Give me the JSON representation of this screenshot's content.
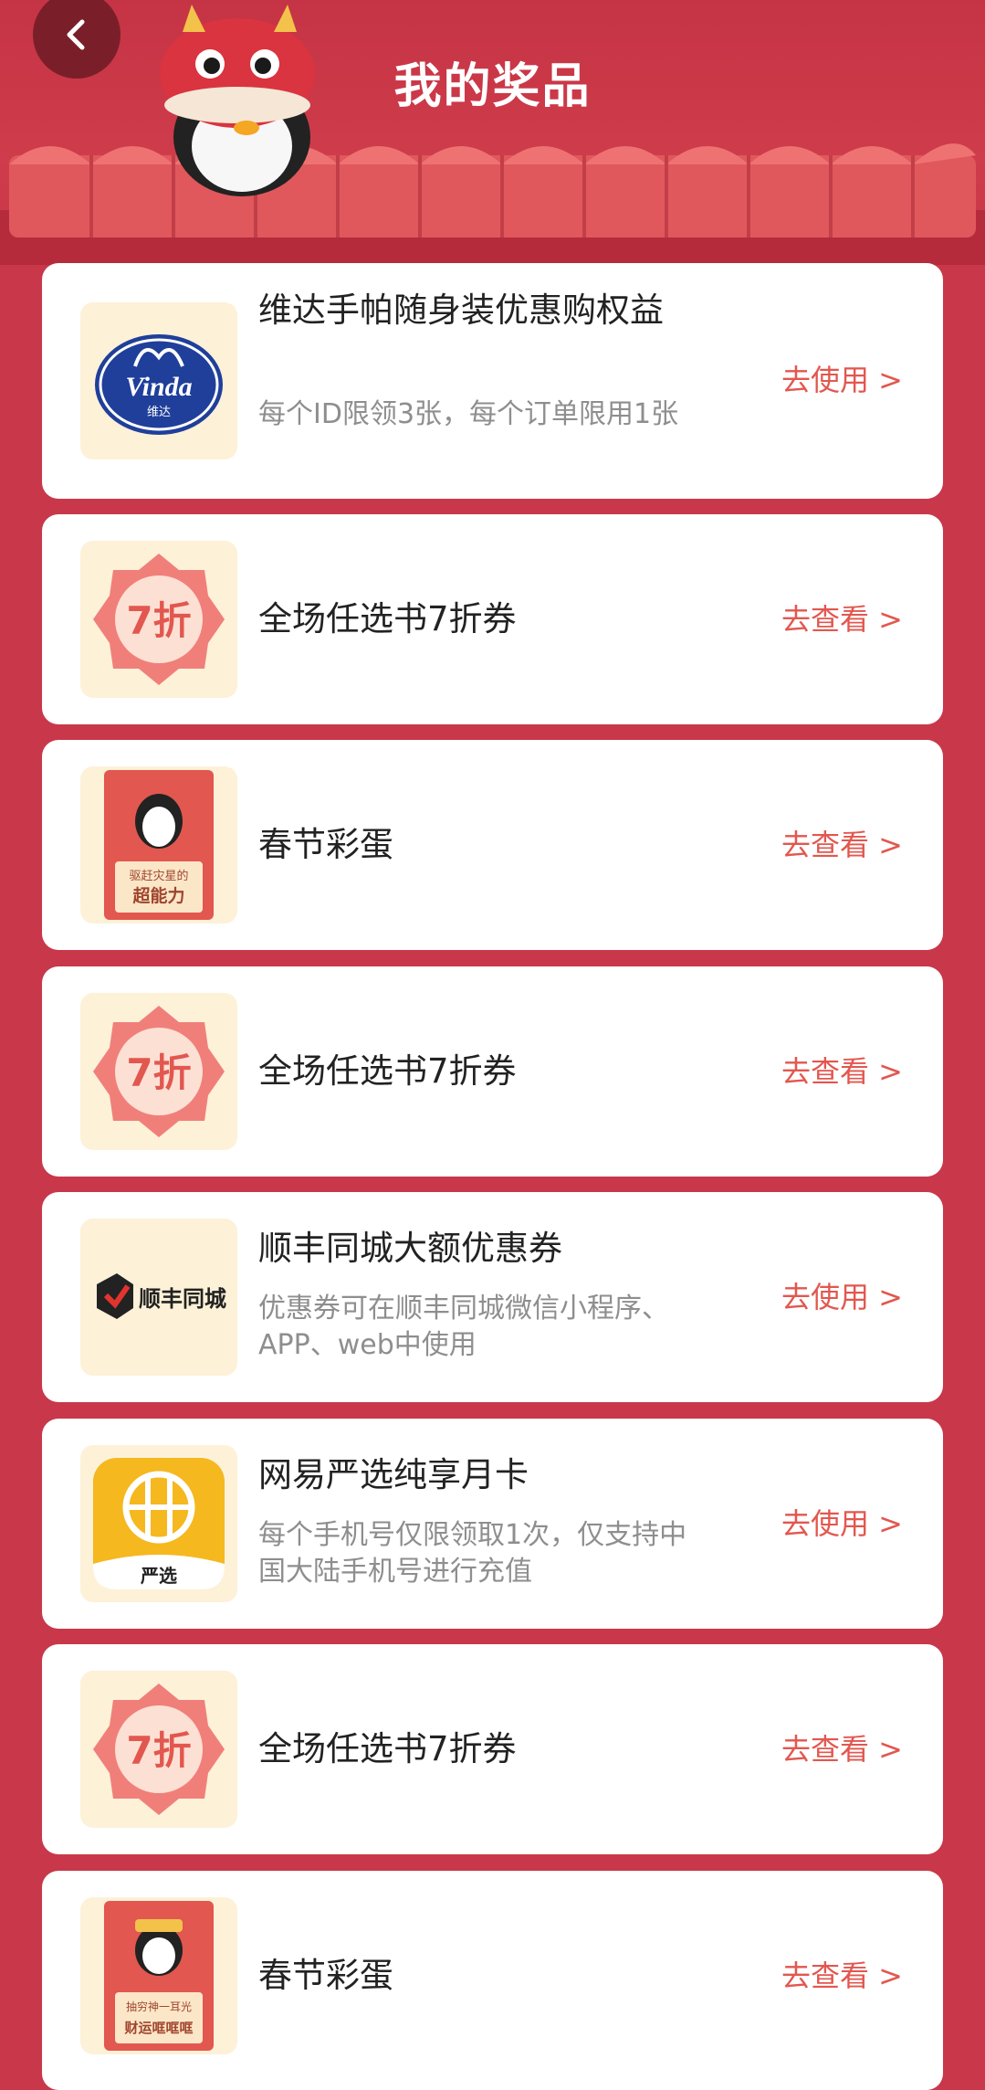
{
  "header": {
    "title": "我的奖品",
    "back_icon": "chevron-left-icon"
  },
  "prizes": [
    {
      "name": "维达手帕随身装优惠购权益",
      "desc": "每个ID限领3张，每个订单限用1张",
      "action": "去使用 >",
      "icon": "vinda-logo",
      "logo_text": "Vinda",
      "logo_sub": "维达"
    },
    {
      "name": "全场任选书7折券",
      "desc": "",
      "action": "去查看 >",
      "icon": "discount-badge-icon",
      "badge": "7折"
    },
    {
      "name": "春节彩蛋",
      "desc": "",
      "action": "去查看 >",
      "icon": "penguin-card-icon",
      "card_text": "驱赶灾星的",
      "card_title": "超能力"
    },
    {
      "name": "全场任选书7折券",
      "desc": "",
      "action": "去查看 >",
      "icon": "discount-badge-icon",
      "badge": "7折"
    },
    {
      "name": "顺丰同城大额优惠券",
      "desc": "优惠券可在顺丰同城微信小程序、APP、web中使用",
      "action": "去使用 >",
      "icon": "sf-logo",
      "logo_text": "顺丰同城"
    },
    {
      "name": "网易严选纯享月卡",
      "desc": "每个手机号仅限领取1次，仅支持中国大陆手机号进行充值",
      "action": "去使用 >",
      "icon": "yanxuan-logo",
      "logo_text": "严选"
    },
    {
      "name": "全场任选书7折券",
      "desc": "",
      "action": "去查看 >",
      "icon": "discount-badge-icon",
      "badge": "7折"
    },
    {
      "name": "春节彩蛋",
      "desc": "",
      "action": "去查看 >",
      "icon": "penguin-card-icon",
      "card_text": "抽穷神一耳光",
      "card_title": "财运哐哐哐"
    }
  ],
  "colors": {
    "background": "#c8384a",
    "accent": "#e2574f",
    "card": "#ffffff",
    "thumb": "#fdf1d8"
  }
}
